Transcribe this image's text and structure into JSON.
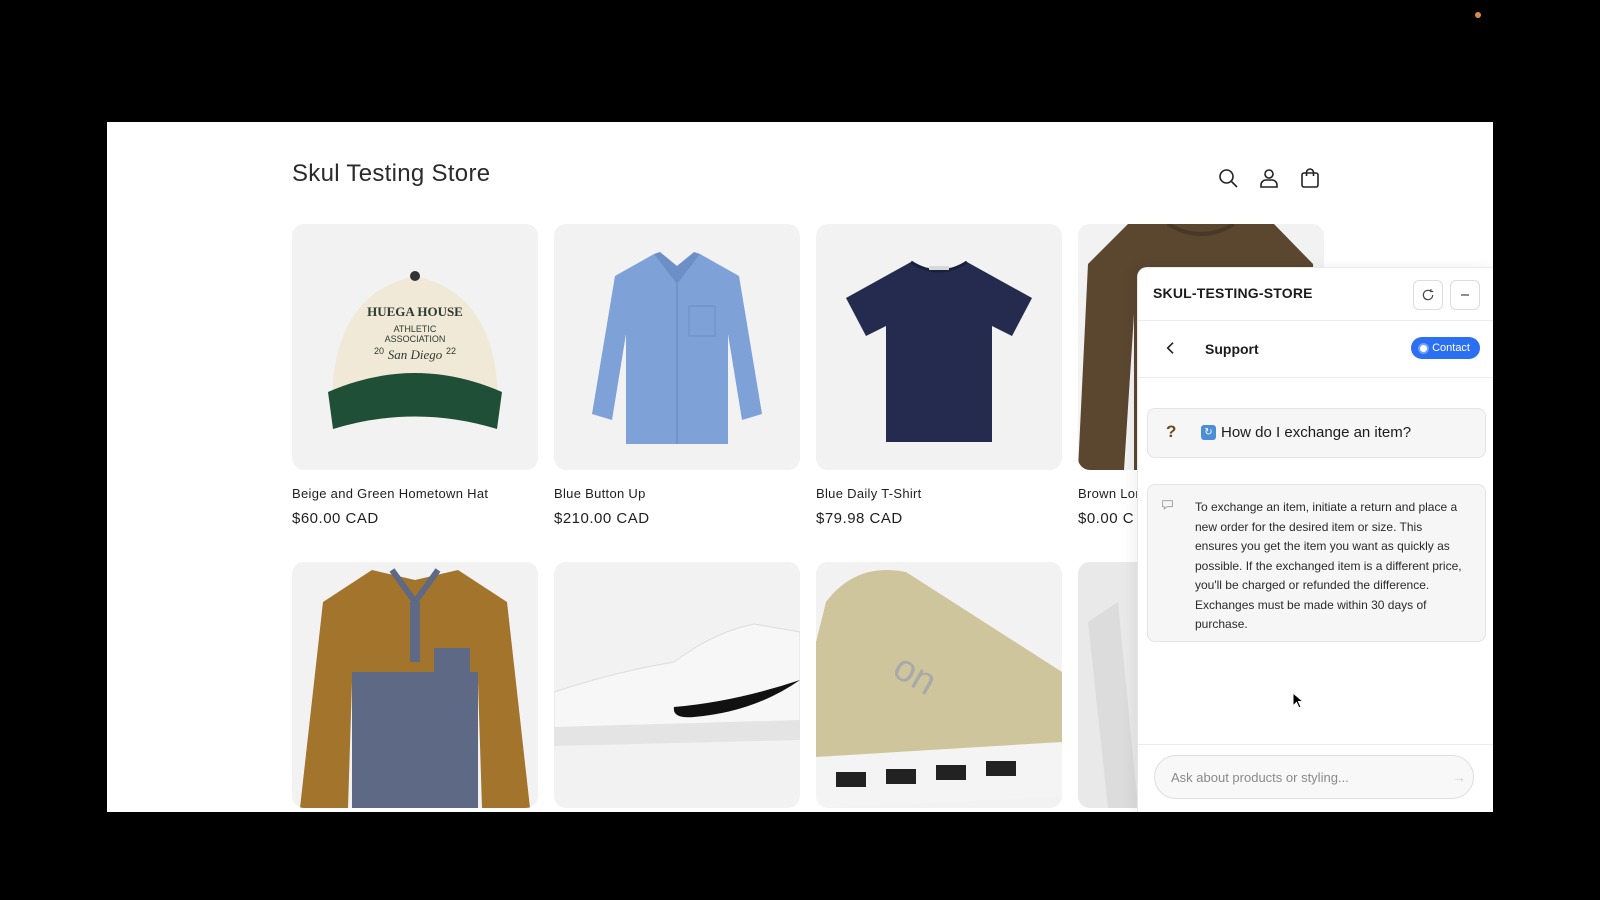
{
  "store": {
    "title": "Skul Testing Store",
    "icons": [
      "search-icon",
      "account-icon",
      "cart-icon"
    ]
  },
  "products": [
    {
      "name": "Beige and Green Hometown Hat",
      "price": "$60.00 CAD",
      "image": "cap"
    },
    {
      "name": "Blue Button Up",
      "price": "$210.00 CAD",
      "image": "shirt"
    },
    {
      "name": "Blue Daily T-Shirt",
      "price": "$79.98 CAD",
      "image": "tshirt"
    },
    {
      "name": "Brown Lor",
      "price": "$0.00 C",
      "image": "sweater"
    }
  ],
  "products_row2": [
    {
      "image": "fleece"
    },
    {
      "image": "sneaker-white"
    },
    {
      "image": "sneaker-beige"
    },
    {
      "image": "longsleeve"
    }
  ],
  "cap_text": {
    "line1": "HUEGA HOUSE",
    "line2": "ATHLETIC",
    "line3": "ASSOCIATION",
    "line4": "San Diego",
    "year_left": "20",
    "year_right": "22"
  },
  "chat": {
    "brand": "SKUL-TESTING-STORE",
    "refresh_icon": "refresh-icon",
    "minimize_icon": "minimize-icon",
    "back_icon": "chevron-left-icon",
    "section_title": "Support",
    "contact_label": "Contact",
    "question_mark": "?",
    "question": "How do I exchange an item?",
    "answer": "To exchange an item, initiate a return and place a new order for the desired item or size. This ensures you get the item you want as quickly as possible. If the exchanged item is a different price, you'll be charged or refunded the difference. Exchanges must be made within 30 days of purchase.",
    "input_placeholder": "Ask about products or styling...",
    "send_icon": "send-arrow-icon"
  },
  "colors": {
    "accent": "#2b6ff2",
    "background": "#000000"
  }
}
